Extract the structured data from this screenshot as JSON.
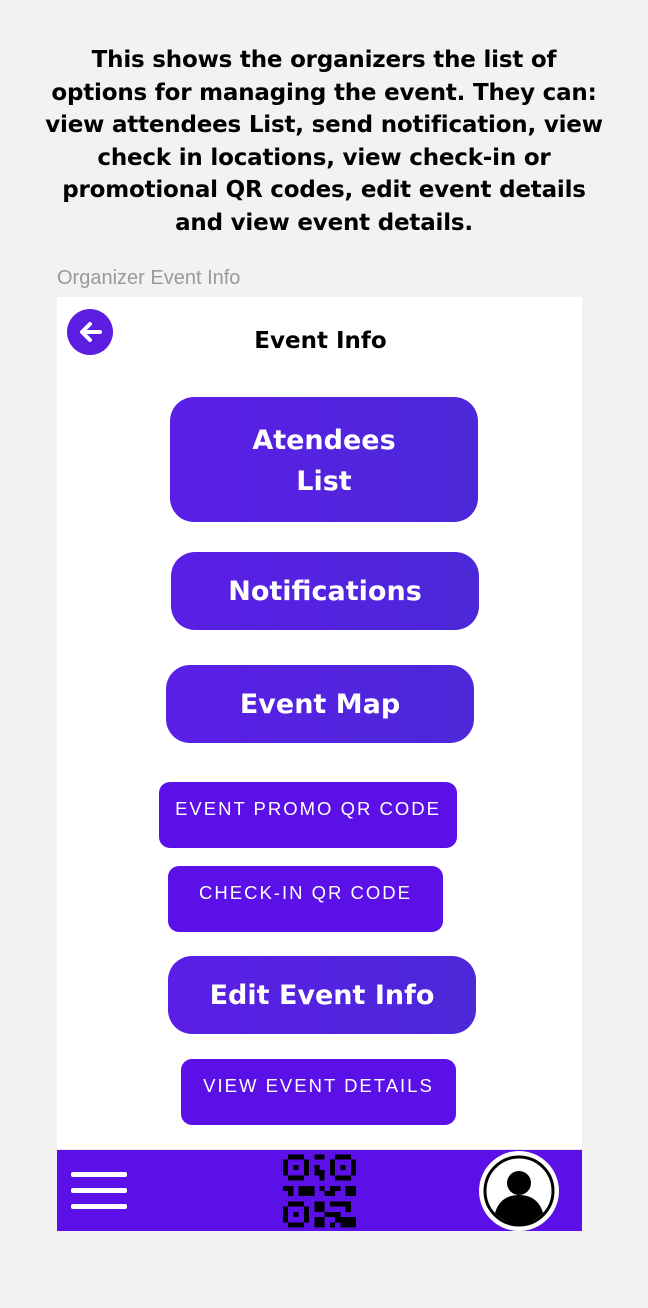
{
  "description": "This shows the organizers the list of options for managing the event. They can: view attendees List, send notification, view check in locations, view check-in or promotional QR codes, edit event details and view event details.",
  "frame_label": "Organizer Event Info",
  "screen": {
    "title": "Event Info",
    "buttons": {
      "attendees_line1": "Atendees",
      "attendees_line2": "List",
      "notifications": "Notifications",
      "event_map": "Event Map",
      "promo_qr": "EVENT PROMO QR CODE",
      "checkin_qr": "CHECK-IN QR CODE",
      "edit_event": "Edit Event Info",
      "view_details": "VIEW EVENT DETAILS"
    }
  },
  "bottom_bar": {
    "icons": [
      "menu-icon",
      "qr-code-icon",
      "profile-icon"
    ]
  },
  "colors": {
    "accent": "#5a10e6",
    "background": "#f2f2f2",
    "screen": "#ffffff"
  }
}
